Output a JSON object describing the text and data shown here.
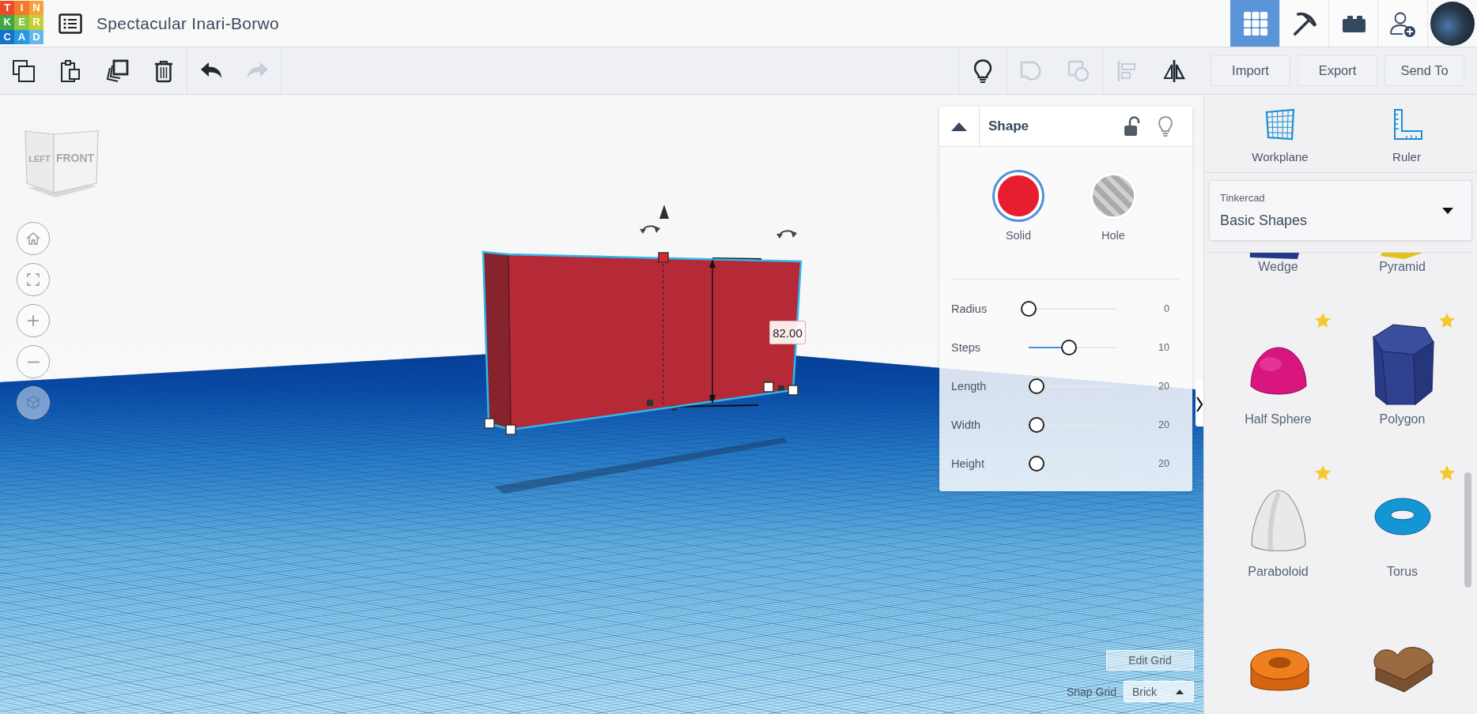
{
  "header": {
    "logo_letters": [
      "T",
      "I",
      "N",
      "K",
      "E",
      "R",
      "C",
      "A",
      "D"
    ],
    "title": "Spectacular Inari-Borwo"
  },
  "header_modes": [
    {
      "kind": "grid",
      "selected": true
    },
    {
      "kind": "pickaxe",
      "selected": false
    },
    {
      "kind": "brick",
      "selected": false
    }
  ],
  "toolbar": {
    "left_groups": [
      [
        {
          "kind": "copy",
          "disabled": false
        },
        {
          "kind": "paste",
          "disabled": false
        },
        {
          "kind": "duplicate",
          "disabled": false
        },
        {
          "kind": "delete",
          "disabled": false
        }
      ],
      [
        {
          "kind": "undo",
          "disabled": false
        },
        {
          "kind": "redo",
          "disabled": true
        }
      ]
    ],
    "right_groups": [
      [
        {
          "kind": "notes",
          "disabled": false
        }
      ],
      [
        {
          "kind": "group",
          "disabled": true
        },
        {
          "kind": "ungroup",
          "disabled": true
        }
      ],
      [
        {
          "kind": "align",
          "disabled": true
        },
        {
          "kind": "mirror",
          "disabled": false
        }
      ]
    ],
    "buttons": [
      "Import",
      "Export",
      "Send To"
    ]
  },
  "viewport": {
    "view_cube": {
      "left": "LEFT",
      "front": "FRONT"
    },
    "nav_buttons": [
      {
        "kind": "home"
      },
      {
        "kind": "fit"
      },
      {
        "kind": "zoom_in"
      },
      {
        "kind": "zoom_out"
      },
      {
        "kind": "projection"
      }
    ],
    "dimension_value": "82.00",
    "edit_grid": "Edit Grid",
    "snap_grid": {
      "label": "Snap Grid",
      "value": "Brick"
    }
  },
  "shape_panel": {
    "title": "Shape",
    "locked": false,
    "modes": [
      {
        "kind": "solid",
        "label": "Solid",
        "selected": true
      },
      {
        "kind": "hole",
        "label": "Hole",
        "selected": false
      }
    ],
    "params": [
      {
        "label": "Radius",
        "value": "0",
        "level": 0
      },
      {
        "label": "Steps",
        "value": "10",
        "level": 0.46
      },
      {
        "label": "Length",
        "value": "20",
        "level": 0.09
      },
      {
        "label": "Width",
        "value": "20",
        "level": 0.09
      },
      {
        "label": "Height",
        "value": "20",
        "level": 0.09
      }
    ]
  },
  "sidebar": {
    "tools": [
      {
        "kind": "workplane",
        "label": "Workplane"
      },
      {
        "kind": "ruler",
        "label": "Ruler"
      }
    ],
    "library": {
      "provider": "Tinkercad",
      "category": "Basic Shapes"
    },
    "shapes": [
      {
        "kind": "wedge",
        "label": "Wedge",
        "starred": false
      },
      {
        "kind": "pyramid",
        "label": "Pyramid",
        "starred": false
      },
      {
        "kind": "half_sphere",
        "label": "Half Sphere",
        "starred": true
      },
      {
        "kind": "polygon",
        "label": "Polygon",
        "starred": true
      },
      {
        "kind": "paraboloid",
        "label": "Paraboloid",
        "starred": true
      },
      {
        "kind": "torus",
        "label": "Torus",
        "starred": true
      },
      {
        "kind": "tube",
        "starred": false
      },
      {
        "kind": "heart",
        "starred": false
      }
    ]
  }
}
